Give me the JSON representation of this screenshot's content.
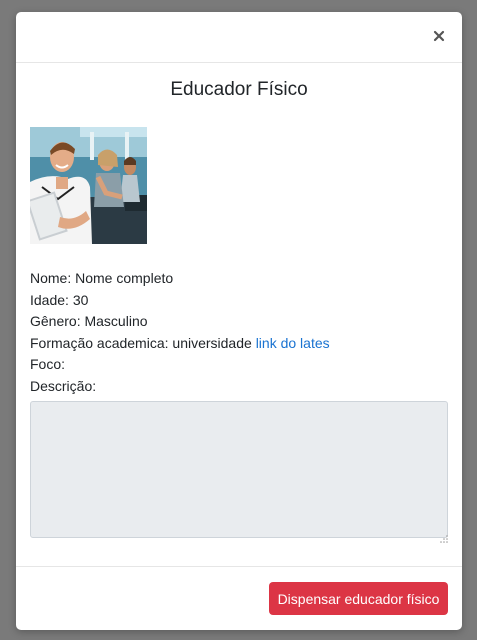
{
  "modal": {
    "close_symbol": "×",
    "title": "Educador Físico",
    "photo_icon": "trainer-photo",
    "info": {
      "nome_label": "Nome:",
      "nome_value": "Nome completo",
      "idade_label": "Idade:",
      "idade_value": "30",
      "genero_label": "Gênero:",
      "genero_value": "Masculino",
      "formacao_label": "Formação academica:",
      "formacao_value": "universidade",
      "formacao_link": "link do lates",
      "foco_label": "Foco:",
      "foco_value": "",
      "descricao_label": "Descrição:"
    },
    "description_value": "",
    "dismiss_button": "Dispensar educador físico"
  },
  "colors": {
    "backdrop": "#7a7a7a",
    "danger": "#dc3545",
    "link": "#1a73d1",
    "disabled_field": "#e9ecef"
  }
}
